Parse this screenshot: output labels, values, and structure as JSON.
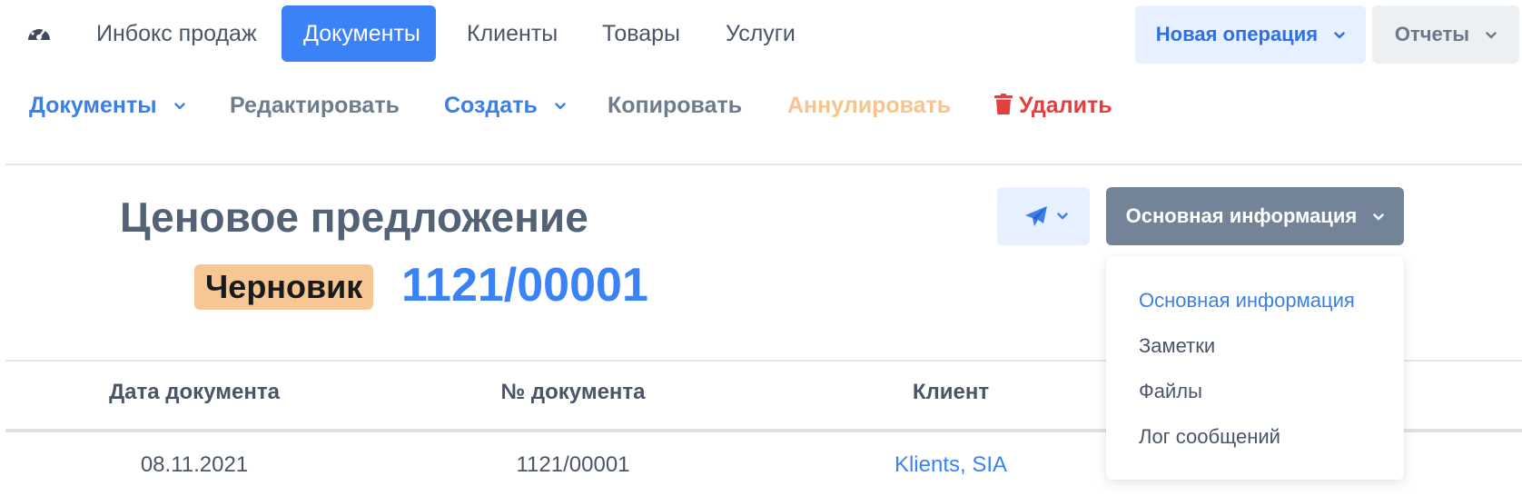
{
  "topnav": {
    "items": [
      {
        "label": "Инбокс продаж",
        "active": false
      },
      {
        "label": "Документы",
        "active": true
      },
      {
        "label": "Клиенты",
        "active": false
      },
      {
        "label": "Товары",
        "active": false
      },
      {
        "label": "Услуги",
        "active": false
      }
    ],
    "new_operation_label": "Новая операция",
    "reports_label": "Отчеты",
    "dashboard_icon": "dashboard-gauge-icon"
  },
  "toolbar": {
    "documents_label": "Документы",
    "edit_label": "Редактировать",
    "create_label": "Создать",
    "copy_label": "Копировать",
    "annul_label": "Аннулировать",
    "delete_label": "Удалить",
    "delete_icon": "trash-icon"
  },
  "document": {
    "title": "Ценовое предложение",
    "status": "Черновик",
    "number": "1121/00001"
  },
  "actions": {
    "send_icon": "paper-plane-icon",
    "section_label": "Основная информация"
  },
  "dropdown": {
    "items": [
      {
        "label": "Основная информация",
        "active": true
      },
      {
        "label": "Заметки",
        "active": false
      },
      {
        "label": "Файлы",
        "active": false
      },
      {
        "label": "Лог сообщений",
        "active": false
      }
    ]
  },
  "table": {
    "headers": [
      "Дата документа",
      "№ документа",
      "Клиент"
    ],
    "row": {
      "date": "08.11.2021",
      "number": "1121/00001",
      "client": "Klients, SIA"
    }
  },
  "colors": {
    "primary": "#3b82f6",
    "status_draft": "#f6c795",
    "danger": "#e53e3e",
    "annul": "#f6c48c",
    "section_button": "#738398"
  }
}
